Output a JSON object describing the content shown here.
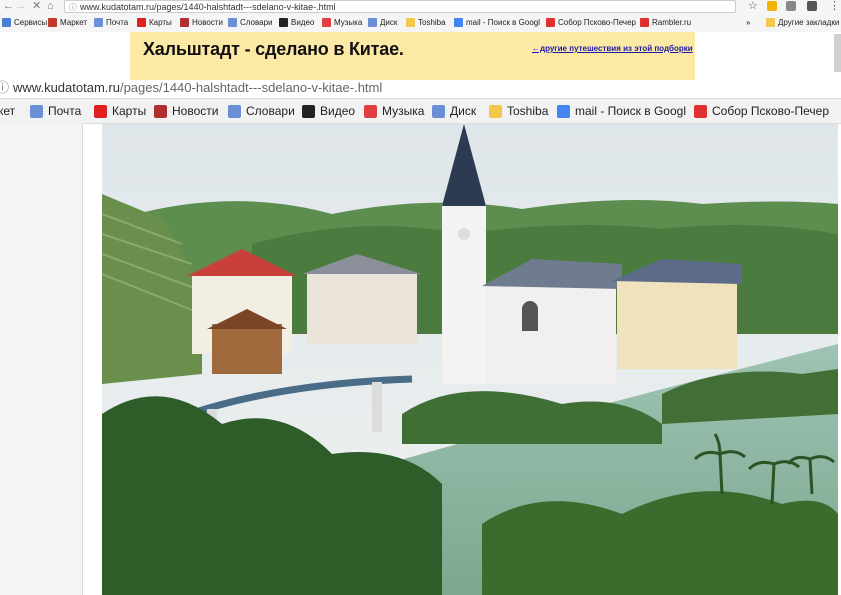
{
  "browser": {
    "url": "www.kudatotam.ru/pages/1440-halshtadt---sdelano-v-kitae-.html",
    "bookmarks": [
      {
        "label": "Сервисы",
        "icon": "apps-icon",
        "color": "#4a7fd6"
      },
      {
        "label": "Маркет",
        "icon": "market-icon",
        "color": "#c0392b"
      },
      {
        "label": "Почта",
        "icon": "mail-icon",
        "color": "#6b8fd6"
      },
      {
        "label": "Карты",
        "icon": "map-pin-icon",
        "color": "#e02020"
      },
      {
        "label": "Новости",
        "icon": "news-icon",
        "color": "#b03030"
      },
      {
        "label": "Словари",
        "icon": "dictionary-icon",
        "color": "#6b8fd6"
      },
      {
        "label": "Видео",
        "icon": "video-icon",
        "color": "#222222"
      },
      {
        "label": "Музыка",
        "icon": "music-icon",
        "color": "#e04040"
      },
      {
        "label": "Диск",
        "icon": "disk-icon",
        "color": "#6b8fd6"
      },
      {
        "label": "Toshiba",
        "icon": "folder-icon",
        "color": "#f2c94c"
      },
      {
        "label": "mail - Поиск в Googl",
        "icon": "google-icon",
        "color": "#4285f4"
      },
      {
        "label": "Собор Псково-Печер",
        "icon": "yandex-icon",
        "color": "#e03030"
      },
      {
        "label": "Rambler.ru",
        "icon": "rambler-icon",
        "color": "#e03030"
      }
    ],
    "overflow": "»",
    "other_bookmarks": "Другие закладки"
  },
  "page": {
    "title": "Хальштадт - сделано в Китае.",
    "link": "←другие путешествия из этой подборки"
  },
  "zoomed": {
    "url_domain": "www.kudatotam.ru",
    "url_path": "/pages/1440-halshtadt---sdelano-v-kitae-.html",
    "bookmarks": [
      {
        "label": "кет",
        "icon": "market-icon",
        "color": "#c0392b"
      },
      {
        "label": "Почта",
        "icon": "mail-icon",
        "color": "#6b8fd6"
      },
      {
        "label": "Карты",
        "icon": "map-pin-icon",
        "color": "#e02020"
      },
      {
        "label": "Новости",
        "icon": "news-icon",
        "color": "#b03030"
      },
      {
        "label": "Словари",
        "icon": "dictionary-icon",
        "color": "#6b8fd6"
      },
      {
        "label": "Видео",
        "icon": "video-icon",
        "color": "#222222"
      },
      {
        "label": "Музыка",
        "icon": "music-icon",
        "color": "#e04040"
      },
      {
        "label": "Диск",
        "icon": "disk-icon",
        "color": "#6b8fd6"
      },
      {
        "label": "Toshiba",
        "icon": "folder-icon",
        "color": "#f2c94c"
      },
      {
        "label": "mail - Поиск в Googl",
        "icon": "google-icon",
        "color": "#4285f4"
      },
      {
        "label": "Собор Псково-Печер",
        "icon": "yandex-icon",
        "color": "#e03030"
      }
    ]
  },
  "colors": {
    "banner": "#fde9a6",
    "link": "#1a1aa6"
  }
}
